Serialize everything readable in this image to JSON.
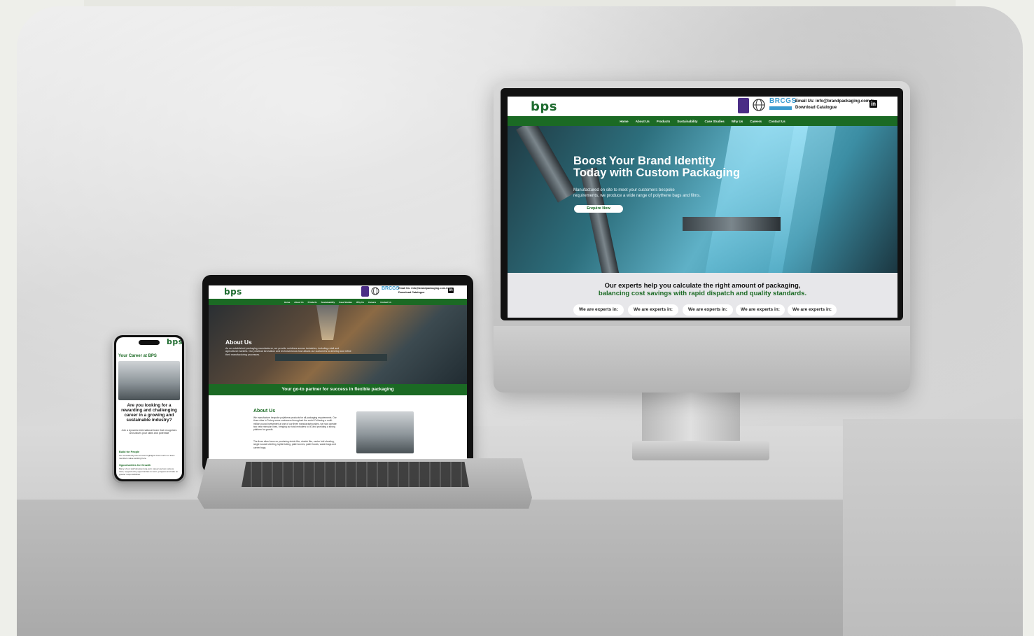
{
  "imac": {
    "logo": "bps",
    "email": "Email Us: info@brandpackaging.com.tr",
    "download": "Download Catalogue",
    "badges": [
      "ukas-badge",
      "iso-badge",
      "brcgs-badge"
    ],
    "brcgs_text": "BRCGS",
    "linkedin": "in",
    "nav": [
      "Home",
      "About Us",
      "Products",
      "Sustainability",
      "Case Studies",
      "Why Us",
      "Careers",
      "Contact Us"
    ],
    "hero_title_1": "Boost Your Brand Identity",
    "hero_title_2": "Today with Custom Packaging",
    "hero_sub_1": "Manufactured on site to meet your customers bespoke",
    "hero_sub_2": "requirements, we produce a wide range of polythene bags and films.",
    "cta": "Enquire Now",
    "band_line_1": "Our experts help you calculate the right amount of packaging,",
    "band_line_2": "balancing cost savings with rapid dispatch and quality standards.",
    "pills": [
      "We are experts in:",
      "We are experts in:",
      "We are experts in:",
      "We are experts in:",
      "We are experts in:"
    ]
  },
  "laptop": {
    "logo": "bps",
    "email": "Email Us: info@brandpackaging.com.tr",
    "download": "Download Catalogue",
    "brcgs_text": "BRCGS",
    "linkedin": "in",
    "nav": [
      "Home",
      "About Us",
      "Products",
      "Sustainability",
      "Case Studies",
      "Why Us",
      "Careers",
      "Contact Us"
    ],
    "hero_title": "About Us",
    "hero_text": "As an established packaging manufacturer, we provide solutions across industries, including retail and agricultural markets. Our practical innovation and technical know-how allows our customers to develop and refine their manufacturing processes.",
    "strip": "Your go-to partner for success in flexible packaging",
    "section_title": "About Us",
    "para_1": "We manufacture bespoke polythene products for all packaging requirements. Our three sites in Turkey serve customers throughout the world. Following a multi-million pound investment at one of our three manufacturing sites, we now operate two new extrusion lines, bringing our total extruders to 40 and providing a strong platform for growth.",
    "para_2": "The three sites focus on producing shrink film, stretch film, centre fold sheeting, single wound sheeting, layflat tubing, pallet covers, pallet hoods, waste bags and carrier bags."
  },
  "phone": {
    "logo": "bps",
    "title": "Your Career at BPS",
    "headline": "Are you looking for a rewarding and challenging career in a growing and sustainable industry?",
    "sub": "Join a dynamic international team that recognises and values your skills and potential!",
    "h_people": "Build for People",
    "p_people": "Our consistently low turnover highlights how much our team members value working here.",
    "h_growth": "Opportunities for Growth",
    "p_growth": "Many of our staff develop long-term careers across various roles, supported by opportunities to learn, progress and take on greater responsibilities."
  },
  "colors": {
    "brand_green": "#1b6a24",
    "accent_green": "#2f8a3a"
  }
}
